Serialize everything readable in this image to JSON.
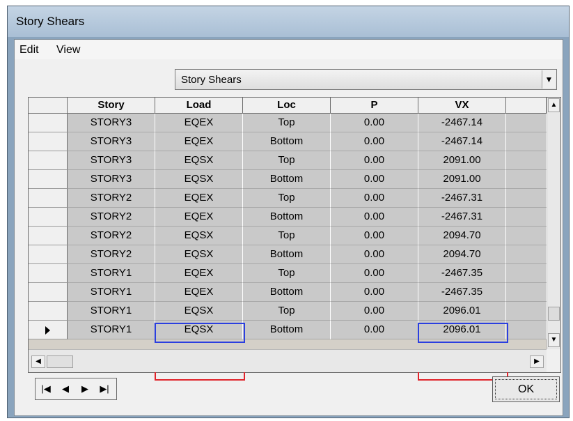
{
  "window": {
    "title": "Story Shears"
  },
  "menu": {
    "items": [
      "Edit",
      "View"
    ]
  },
  "selector": {
    "value": "Story Shears"
  },
  "table": {
    "columns": [
      "Story",
      "Load",
      "Loc",
      "P",
      "VX"
    ],
    "rows": [
      [
        "STORY3",
        "EQEX",
        "Top",
        "0.00",
        "-2467.14"
      ],
      [
        "STORY3",
        "EQEX",
        "Bottom",
        "0.00",
        "-2467.14"
      ],
      [
        "STORY3",
        "EQSX",
        "Top",
        "0.00",
        "2091.00"
      ],
      [
        "STORY3",
        "EQSX",
        "Bottom",
        "0.00",
        "2091.00"
      ],
      [
        "STORY2",
        "EQEX",
        "Top",
        "0.00",
        "-2467.31"
      ],
      [
        "STORY2",
        "EQEX",
        "Bottom",
        "0.00",
        "-2467.31"
      ],
      [
        "STORY2",
        "EQSX",
        "Top",
        "0.00",
        "2094.70"
      ],
      [
        "STORY2",
        "EQSX",
        "Bottom",
        "0.00",
        "2094.70"
      ],
      [
        "STORY1",
        "EQEX",
        "Top",
        "0.00",
        "-2467.35"
      ],
      [
        "STORY1",
        "EQEX",
        "Bottom",
        "0.00",
        "-2467.35"
      ],
      [
        "STORY1",
        "EQSX",
        "Top",
        "0.00",
        "2096.01"
      ],
      [
        "STORY1",
        "EQSX",
        "Bottom",
        "0.00",
        "2096.01"
      ]
    ],
    "current_row": 12,
    "highlight_colors": {
      "blue": "#2b3fe0",
      "red": "#e0242b"
    }
  },
  "icons": {
    "dropdown": "chevron-down-icon",
    "row_pointer": "row-pointer-icon",
    "nav": [
      "first-record-icon",
      "previous-record-icon",
      "next-record-icon",
      "last-record-icon"
    ]
  },
  "buttons": {
    "ok": "OK"
  }
}
